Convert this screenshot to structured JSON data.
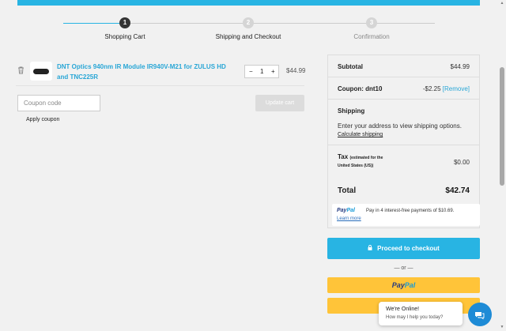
{
  "steps": [
    {
      "number": "1",
      "label": "Shopping Cart"
    },
    {
      "number": "2",
      "label": "Shipping and Checkout"
    },
    {
      "number": "3",
      "label": "Confirmation"
    }
  ],
  "cart": {
    "item": {
      "name": "DNT Optics 940nm IR Module IR940V-M21 for ZULUS HD and TNC225R",
      "quantity": "1",
      "price": "$44.99",
      "minus": "−",
      "plus": "+"
    },
    "coupon_placeholder": "Coupon code",
    "apply_coupon": "Apply coupon",
    "update_cart": "Update cart"
  },
  "summary": {
    "subtotal_label": "Subtotal",
    "subtotal_value": "$44.99",
    "coupon_label": "Coupon: dnt10",
    "coupon_value": "-$2.25",
    "coupon_remove": "[Remove]",
    "shipping_label": "Shipping",
    "shipping_text": "Enter your address to view shipping options.",
    "calculate_shipping": "Calculate shipping",
    "tax_label": "Tax",
    "tax_note_1": "(estimated for the",
    "tax_note_2": "United States (US))",
    "tax_value": "$0.00",
    "total_label": "Total",
    "total_value": "$42.74"
  },
  "paypal_message": {
    "logo_pay": "Pay",
    "logo_pal": "Pal",
    "text": "Pay in 4 interest-free payments of $10.69.",
    "learn_more": "Learn more"
  },
  "checkout": {
    "proceed_label": "Proceed to checkout",
    "or_text": "— or —",
    "paypal_pay": "Pay",
    "paypal_pal": "Pal"
  },
  "chat": {
    "title": "We're Online!",
    "subtitle": "How may I help you today?"
  },
  "colors": {
    "accent": "#28b4e3",
    "paypal_yellow": "#ffc439",
    "chat_blue": "#1e8bd6"
  }
}
